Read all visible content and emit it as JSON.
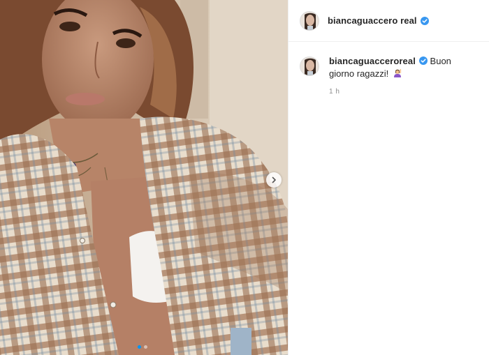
{
  "post": {
    "author": {
      "username": "biancaguaccero real",
      "verified": true,
      "verified_icon": "verified-badge-icon"
    },
    "caption": {
      "username": "biancaguacceroreal",
      "text": "Buon giorno ragazzi!",
      "emoji": "woman-raising-hand-emoji"
    },
    "timestamp": "1 h",
    "carousel": {
      "current_slide": 1,
      "total_slides": 2,
      "next_icon": "chevron-right-icon"
    },
    "colors": {
      "verified_blue": "#3897f0",
      "active_dot": "#0095f6",
      "border": "#efefef",
      "muted_text": "#8e8e8e"
    }
  }
}
